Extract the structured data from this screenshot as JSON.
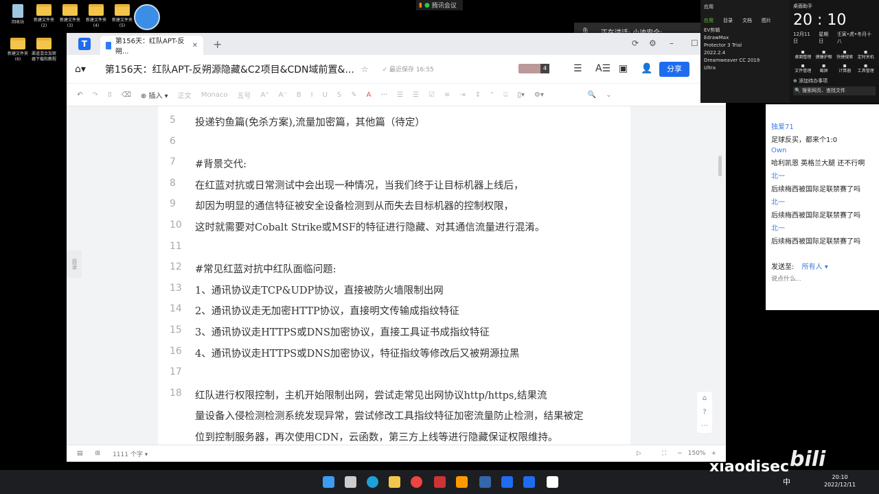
{
  "desktop": {
    "icons": [
      {
        "label": "回收站",
        "type": "bin"
      },
      {
        "label": "新建文件夹 (2)",
        "type": "folder"
      },
      {
        "label": "新建文件夹 (3)",
        "type": "folder"
      },
      {
        "label": "新建文件夹 (4)",
        "type": "folder"
      },
      {
        "label": "新建文件夹 (5)",
        "type": "folder"
      },
      {
        "label": "新建文件夹 (6)",
        "type": "folder"
      },
      {
        "label": "渠道混合加密器下载和教程",
        "type": "folder"
      }
    ]
  },
  "meeting": {
    "label": "腾讯会议",
    "speaking": "正在讲话: 小迪安全;"
  },
  "window": {
    "tab_title": "第156天：红队APT-反朔...",
    "doc_title": "第156天：红队APT-反朔源隐藏&C2项目&CDN域前置&...",
    "saved": "最近保存 16:55",
    "collab_count": "4",
    "share": "分享",
    "toolbar": {
      "insert": "插入",
      "style": "正文",
      "font": "Monaco",
      "size": "五号"
    },
    "toc": "目录",
    "lines": [
      {
        "n": "5",
        "t": "投递钓鱼篇(免杀方案),流量加密篇，其他篇（待定）"
      },
      {
        "n": "6",
        "t": ""
      },
      {
        "n": "7",
        "t": "#背景交代:"
      },
      {
        "n": "8",
        "t": "在红蓝对抗或日常测试中会出现一种情况，当我们终于让目标机器上线后，"
      },
      {
        "n": "9",
        "t": "却因为明显的通信特征被安全设备检测到从而失去目标机器的控制权限，"
      },
      {
        "n": "10",
        "t": "这时就需要对Cobalt Strike或MSF的特征进行隐藏、对其通信流量进行混淆。"
      },
      {
        "n": "11",
        "t": ""
      },
      {
        "n": "12",
        "t": "#常见红蓝对抗中红队面临问题:"
      },
      {
        "n": "13",
        "t": "1、通讯协议走TCP&UDP协议，直接被防火墙限制出网"
      },
      {
        "n": "14",
        "t": "2、通讯协议走无加密HTTP协议，直接明文传输成指纹特征"
      },
      {
        "n": "15",
        "t": "3、通讯协议走HTTPS或DNS加密协议，直接工具证书成指纹特征"
      },
      {
        "n": "16",
        "t": "4、通讯协议走HTTPS或DNS加密协议，特征指纹等修改后又被朔源拉黑"
      },
      {
        "n": "17",
        "t": ""
      },
      {
        "n": "18",
        "t": "      红队进行权限控制，主机开始限制出网，尝试走常见出网协议http/https,结果流"
      },
      {
        "n": "",
        "t": "量设备入侵检测检测系统发现异常，尝试修改工具指纹特征加密流量防止检测，结果被定"
      },
      {
        "n": "",
        "t": "位到控制服务器，再次使用CDN，云函数，第三方上线等进行隐藏保证权限维持。"
      }
    ],
    "word_count": "1111 个字",
    "zoom": "150%"
  },
  "apps_panel": {
    "title": "应用",
    "tabs": [
      "应用",
      "目录",
      "文档",
      "图片"
    ],
    "items": [
      "EV剪辑",
      "EdrawMax",
      "Protector 3 Trial",
      "2022.2.4",
      "Dreamweaver CC 2019",
      "Ultra"
    ]
  },
  "clock_panel": {
    "title": "桌面助手",
    "time": "20 : 10",
    "date": "12月11日",
    "weekday": "星期日",
    "lunar": "壬寅•虎•冬月十八",
    "tools": [
      "桌面整理",
      "健康护眼",
      "快捷搜索",
      "定时关机",
      "文件管理",
      "截屏",
      "计算器",
      "工具管理"
    ],
    "todo": "添加待办事项",
    "search": "搜索网页、查找文件"
  },
  "chat": {
    "messages": [
      {
        "name": "独爱71",
        "text": "足球反买，都来个1:0"
      },
      {
        "name": "Own",
        "text": "哈利凯恩  英格兰大腿 还不行啊"
      },
      {
        "name": "北一",
        "text": "后续梅西被国际足联禁赛了吗"
      },
      {
        "name": "北一",
        "text": "后续梅西被国际足联禁赛了吗"
      },
      {
        "name": "北一",
        "text": "后续梅西被国际足联禁赛了吗"
      }
    ],
    "send_to_label": "发送至:",
    "send_to": "所有人",
    "placeholder": "说点什么..."
  },
  "watermark": "xiaodisec",
  "bilibili": "bilibili",
  "taskbar": {
    "time": "20:10",
    "date": "2022/12/11",
    "ime": "中"
  }
}
